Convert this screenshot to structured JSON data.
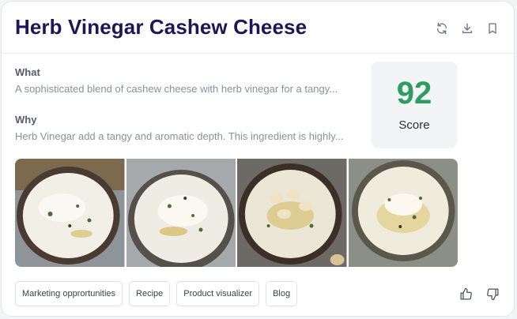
{
  "card": {
    "title": "Herb Vinegar Cashew Cheese",
    "what_label": "What",
    "what_text": "A sophisticated blend of cashew cheese with herb vinegar for a tangy...",
    "why_label": "Why",
    "why_text": "Herb Vinegar add a tangy and aromatic depth. This ingredient is highly...",
    "score_value": "92",
    "score_label": "Score"
  },
  "header_icons": [
    "refresh-icon",
    "download-icon",
    "bookmark-icon"
  ],
  "gallery": [
    "cashew-cheese-photo-1",
    "cashew-cheese-photo-2",
    "cashew-cheese-photo-3",
    "cashew-cheese-photo-4"
  ],
  "tags": [
    "Marketing opprortunities",
    "Recipe",
    "Product visualizer",
    "Blog"
  ],
  "feedback_icons": [
    "thumbs-up-icon",
    "thumbs-down-icon"
  ],
  "colors": {
    "title": "#1c1757",
    "score": "#2e9d60",
    "score_bg": "#f3f4f6"
  }
}
